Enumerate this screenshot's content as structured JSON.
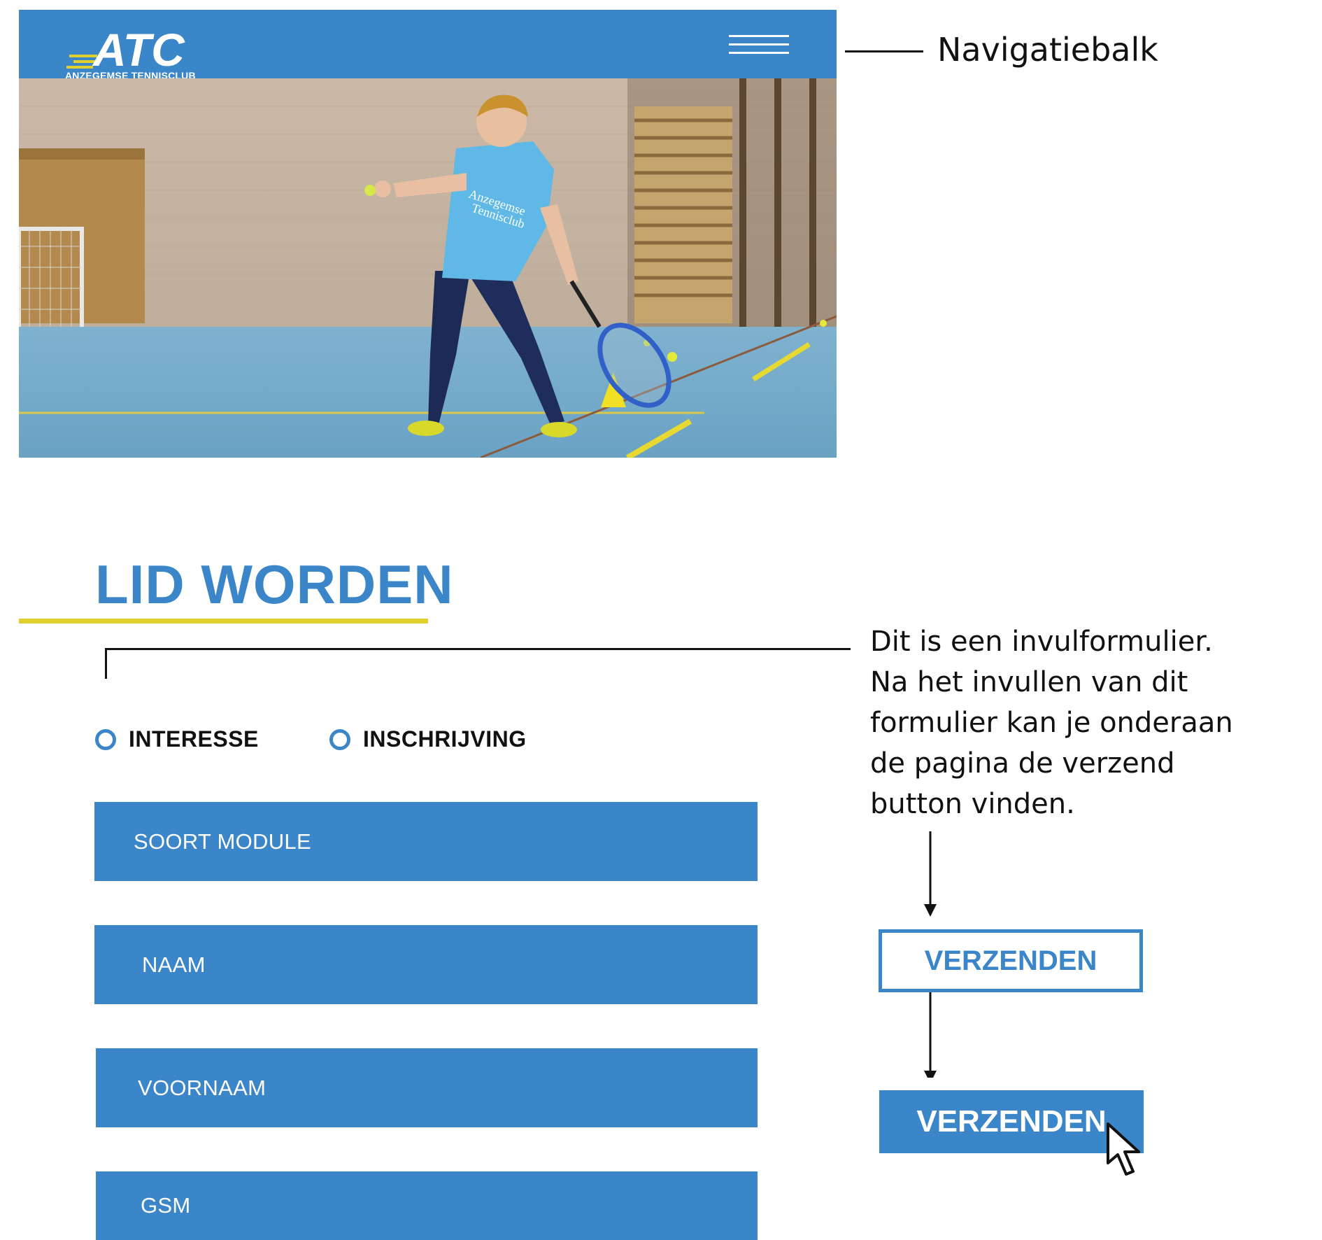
{
  "navbar": {
    "logo_text": "ATC",
    "logo_subtitle": "ANZEGEMSE TENNISCLUB",
    "menu_icon": "hamburger-menu-icon"
  },
  "hero": {
    "shirt_text_line1": "Anzegemse",
    "shirt_text_line2": "Tennisclub"
  },
  "annotations": {
    "nav_label": "Navigatiebalk",
    "form_description_lines": [
      "Dit is een invulformulier.",
      "Na het invullen van dit",
      "formulier kan je onderaan",
      "de pagina de verzend",
      "button vinden."
    ]
  },
  "form": {
    "title": "LID WORDEN",
    "radio_options": [
      "INTERESSE",
      "INSCHRIJVING"
    ],
    "fields": {
      "soort_module": "SOORT MODULE",
      "naam": "NAAM",
      "voornaam": "VOORNAAM",
      "gsm": "GSM"
    }
  },
  "buttons": {
    "submit_default": "VERZENDEN",
    "submit_hover": "VERZENDEN"
  },
  "colors": {
    "primary_blue": "#3a86c8",
    "accent_yellow": "#dfcf2f",
    "text_dark": "#111111",
    "background": "#ffffff"
  }
}
